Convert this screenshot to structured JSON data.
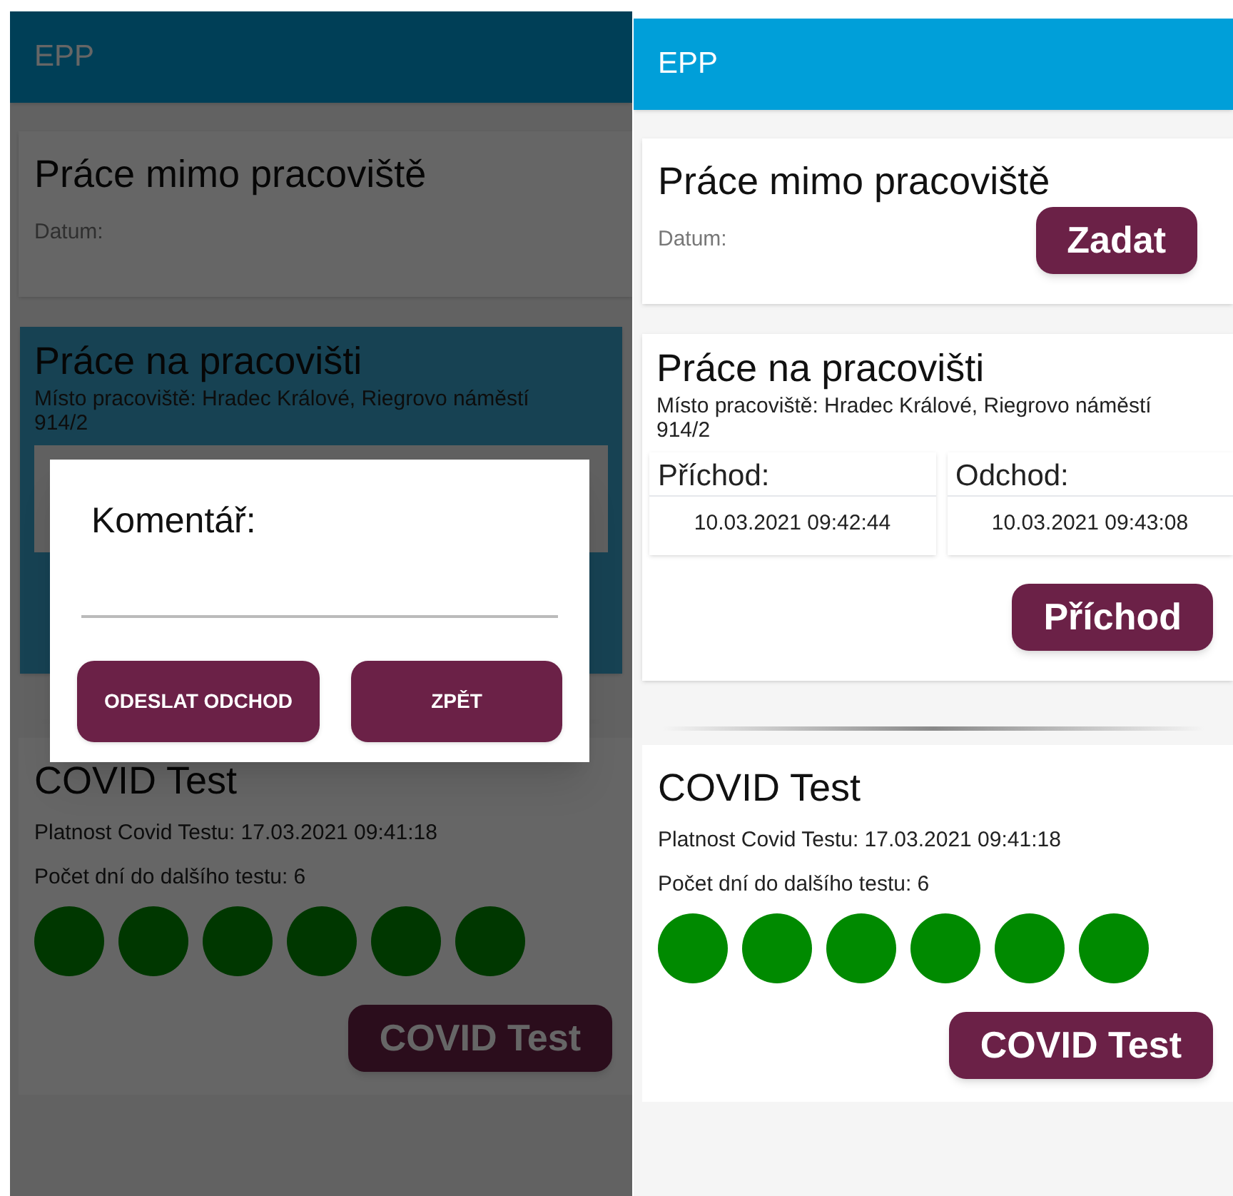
{
  "screens": [
    {
      "dimmed": true,
      "app_bar": {
        "title": "EPP"
      },
      "off_site": {
        "title": "Práce mimo pracoviště",
        "date_label": "Datum:"
      },
      "on_site": {
        "pressed": true,
        "title": "Práce na pracovišti",
        "location": "Místo pracoviště: Hradec Králové, Riegrovo náměstí 914/2"
      },
      "covid": {
        "title": "COVID Test",
        "validity": "Platnost Covid Testu: 17.03.2021 09:41:18",
        "days_left": "Počet dní do dalšího testu: 6",
        "indicator": {
          "stars": 6
        },
        "button": "COVID Test"
      },
      "dialog": {
        "title": "Komentář:",
        "buttons": [
          "ODESLAT ODCHOD",
          "ZPĚT"
        ]
      }
    },
    {
      "dimmed": false,
      "app_bar": {
        "title": "EPP"
      },
      "off_site": {
        "title": "Práce mimo pracoviště",
        "date_label": "Datum:",
        "button": "Zadat"
      },
      "on_site": {
        "pressed": false,
        "title": "Práce na pracovišti",
        "location": "Místo pracoviště: Hradec Králové, Riegrovo náměstí 914/2",
        "arrival": {
          "label": "Příchod:",
          "value": "10.03.2021 09:42:44"
        },
        "departure": {
          "label": "Odchod:",
          "value": "10.03.2021 09:43:08"
        },
        "button": "Příchod"
      },
      "covid": {
        "title": "COVID Test",
        "validity": "Platnost Covid Testu: 17.03.2021 09:41:18",
        "days_left": "Počet dní do dalšího testu: 6",
        "indicator": {
          "stars": 6
        },
        "button": "COVID Test"
      }
    }
  ]
}
